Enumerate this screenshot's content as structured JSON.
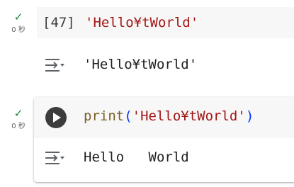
{
  "cell1": {
    "status_icon": "check-icon",
    "duration": "0 秒",
    "execution_count": "[47]",
    "code": "'Hello¥tWorld'",
    "output": "'Hello¥tWorld'"
  },
  "cell2": {
    "status_icon": "check-icon",
    "duration": "0 秒",
    "code": {
      "function": "print",
      "open_paren": "(",
      "argument": "'Hello¥tWorld'",
      "close_paren": ")"
    },
    "output": "Hello   World"
  },
  "colors": {
    "success": "#188038",
    "string": "#a31515",
    "function": "#795e26",
    "paren": "#0431fa",
    "cell_background": "#f7f7f7"
  },
  "icons": {
    "output_icon": "output-options-icon",
    "run_icon": "play-icon"
  }
}
